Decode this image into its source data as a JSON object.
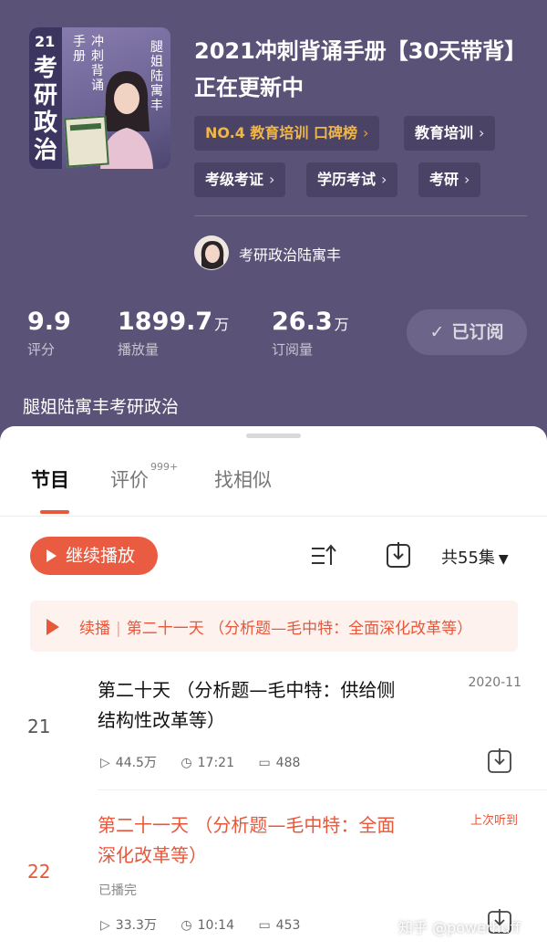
{
  "header": {
    "title": "2021冲刺背诵手册【30天带背】正在更新中",
    "cover": {
      "year": "21",
      "big_text": "考研政治",
      "sub_line1": "手册",
      "sub_line2": "冲刺背诵",
      "author_vertical": "腿姐陆寓丰"
    },
    "tags": [
      {
        "label": "NO.4 教育培训 口碑榜"
      },
      {
        "label": "教育培训"
      },
      {
        "label": "考级考证"
      },
      {
        "label": "学历考试"
      },
      {
        "label": "考研"
      }
    ],
    "author": {
      "name": "考研政治陆寓丰"
    },
    "stats": [
      {
        "value": "9.9",
        "unit": "",
        "label": "评分"
      },
      {
        "value": "1899.7",
        "unit": "万",
        "label": "播放量"
      },
      {
        "value": "26.3",
        "unit": "万",
        "label": "订阅量"
      }
    ],
    "subscribed_label": "已订阅",
    "description": "腿姐陆寓丰考研政治"
  },
  "tabs": [
    {
      "label": "节目",
      "badge": ""
    },
    {
      "label": "评价",
      "badge": "999+"
    },
    {
      "label": "找相似",
      "badge": ""
    }
  ],
  "toolbar": {
    "continue_label": "继续播放",
    "episode_count": "共55集"
  },
  "resume": {
    "prefix": "续播",
    "separator": "|",
    "title": "第二十一天 （分析题—毛中特：全面深化改革等）"
  },
  "episodes": [
    {
      "number": "21",
      "title": "第二十天 （分析题—毛中特：供给侧结构性改革等）",
      "date": "2020-11",
      "plays": "44.5万",
      "duration": "17:21",
      "comments": "488"
    },
    {
      "number": "22",
      "title": "第二十一天 （分析题—毛中特：全面深化改革等）",
      "badge": "上次听到",
      "status": "已播完",
      "plays": "33.3万",
      "duration": "10:14",
      "comments": "453"
    }
  ],
  "watermark": "知乎 @powerhuff",
  "icons": {
    "continue": "play-icon",
    "sort": "sort-icon",
    "download": "download-icon",
    "plays": "play-outline-icon",
    "duration": "clock-icon",
    "comments": "comment-icon"
  },
  "colors": {
    "hero_bg": "#5b5377",
    "accent": "#e8573a",
    "rank_tag": "#f0b64a"
  }
}
